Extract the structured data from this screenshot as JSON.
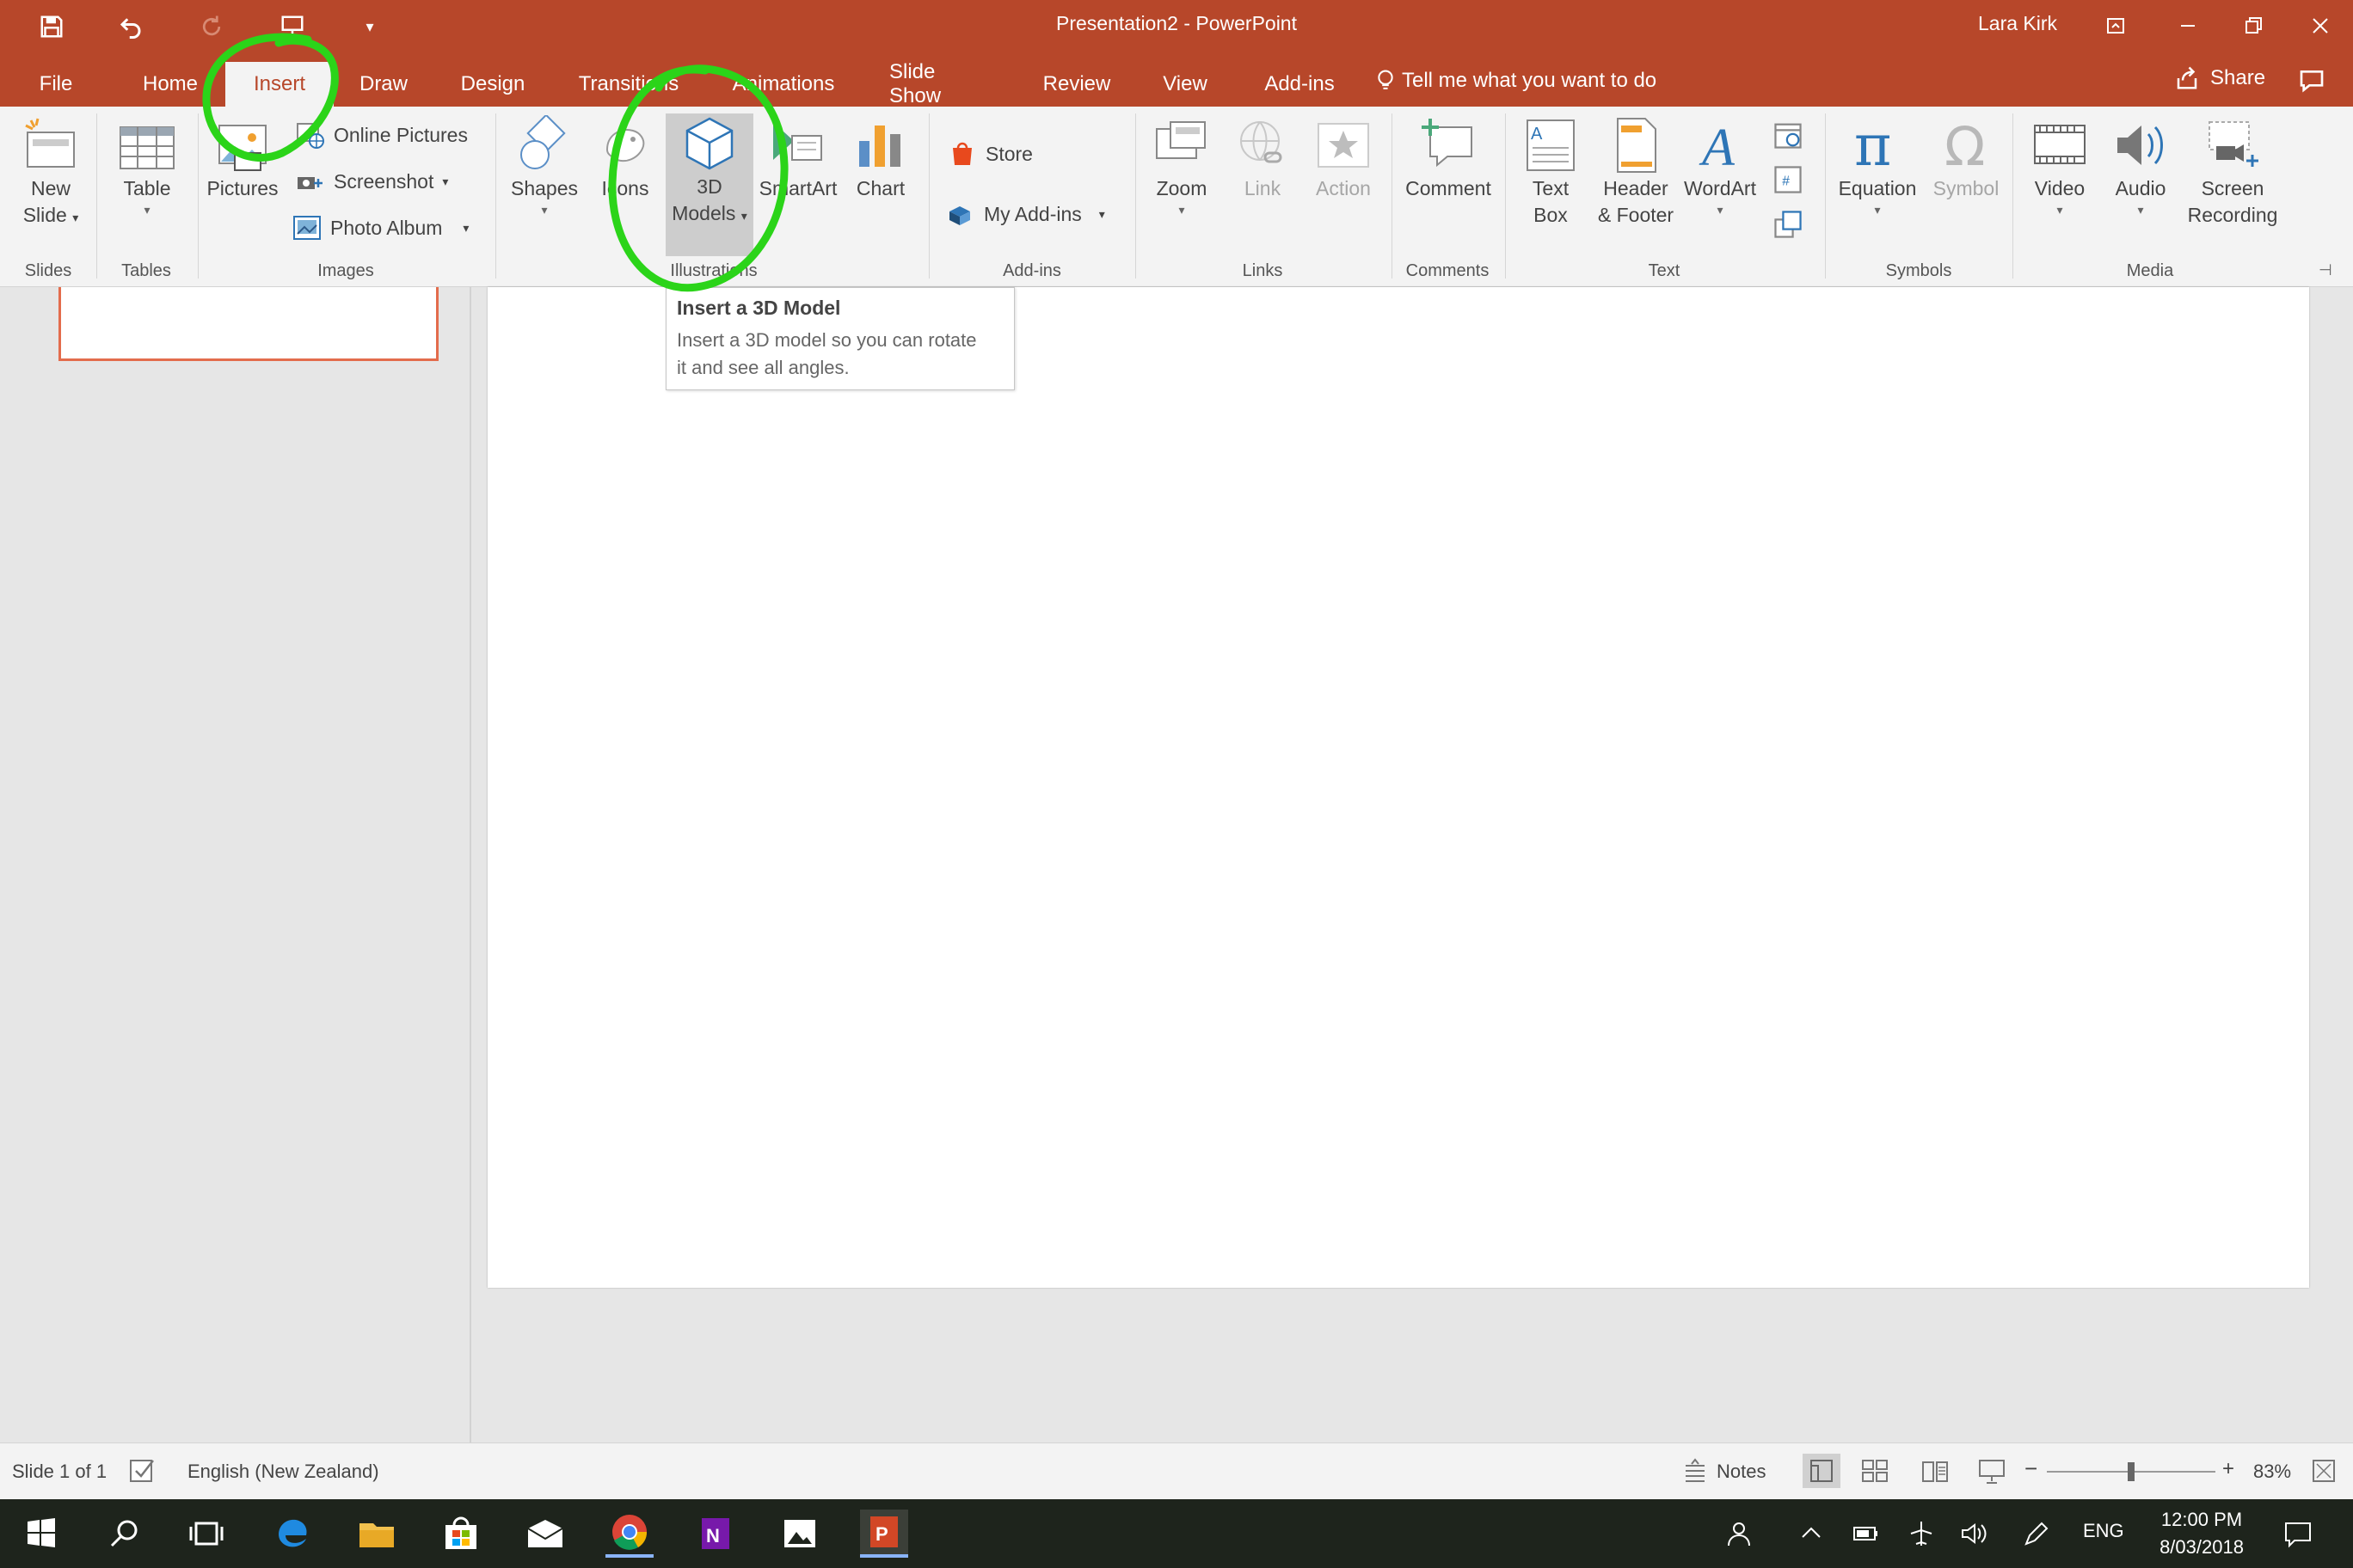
{
  "titlebar": {
    "title": "Presentation2  -  PowerPoint",
    "user": "Lara Kirk"
  },
  "tabs": [
    "File",
    "Home",
    "Insert",
    "Draw",
    "Design",
    "Transitions",
    "Animations",
    "Slide Show",
    "Review",
    "View",
    "Add-ins"
  ],
  "active_tab": "Insert",
  "tell_me": "Tell me what you want to do",
  "share": "Share",
  "ribbon": {
    "slides": {
      "new_slide_line1": "New",
      "new_slide_line2": "Slide",
      "label": "Slides"
    },
    "tables": {
      "table": "Table",
      "label": "Tables"
    },
    "images": {
      "pictures": "Pictures",
      "online_pictures": "Online Pictures",
      "screenshot": "Screenshot",
      "photo_album": "Photo Album",
      "label": "Images"
    },
    "illustrations": {
      "shapes": "Shapes",
      "icons": "Icons",
      "models_line1": "3D",
      "models_line2": "Models",
      "smartart": "SmartArt",
      "chart": "Chart",
      "label": "Illustrations"
    },
    "addins": {
      "store": "Store",
      "my_addins": "My Add-ins",
      "label": "Add-ins"
    },
    "links": {
      "zoom": "Zoom",
      "link": "Link",
      "action": "Action",
      "label": "Links"
    },
    "comments": {
      "comment": "Comment",
      "label": "Comments"
    },
    "text": {
      "textbox_line1": "Text",
      "textbox_line2": "Box",
      "header_line1": "Header",
      "header_line2": "& Footer",
      "wordart": "WordArt",
      "label": "Text"
    },
    "symbols": {
      "equation": "Equation",
      "symbol": "Symbol",
      "label": "Symbols"
    },
    "media": {
      "video": "Video",
      "audio": "Audio",
      "screen_line1": "Screen",
      "screen_line2": "Recording",
      "label": "Media"
    }
  },
  "tooltip": {
    "title": "Insert a 3D Model",
    "body_line1": "Insert a 3D model so you can rotate",
    "body_line2": "it and see all angles."
  },
  "statusbar": {
    "slide_count": "Slide 1 of 1",
    "language": "English (New Zealand)",
    "notes": "Notes",
    "zoom": "83%",
    "zoom_level_fraction": 0.5
  },
  "taskbar": {
    "language": "ENG",
    "time": "12:00 PM",
    "date": "8/03/2018"
  },
  "colors": {
    "accent": "#b7472a",
    "annotation": "#2bd419",
    "ribbon_bg": "#f3f3f3",
    "workspace_bg": "#e6e6e6"
  }
}
